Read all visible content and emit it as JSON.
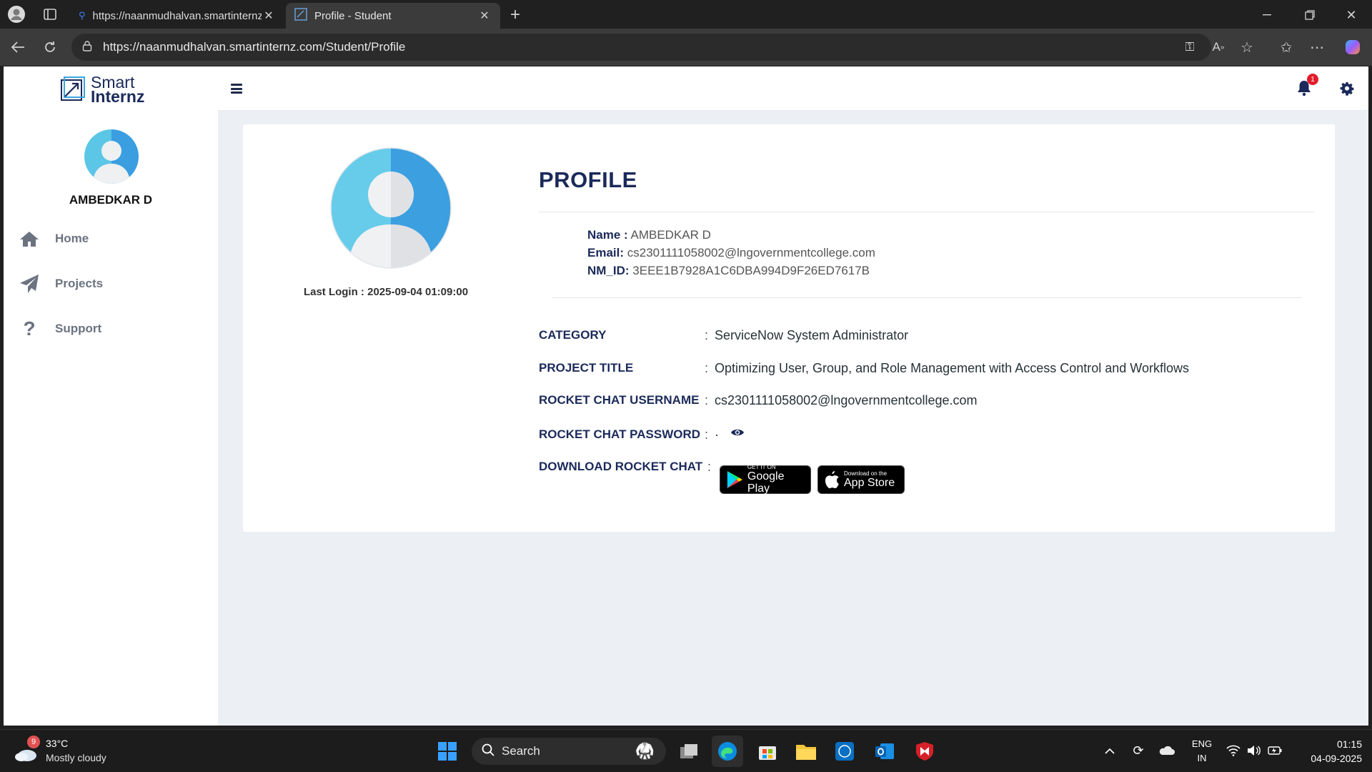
{
  "browser": {
    "tabs": [
      {
        "title": "https://naanmudhalvan.smartinternz.com",
        "icon": "search-icon",
        "active": false
      },
      {
        "title": "Profile - Student",
        "icon": "favicon-icon",
        "active": true
      }
    ],
    "url": "https://naanmudhalvan.smartinternz.com/Student/Profile"
  },
  "app": {
    "logo": {
      "line1": "Smart",
      "line2": "Internz"
    },
    "user_name": "AMBEDKAR D",
    "nav": [
      {
        "label": "Home",
        "icon": "home-icon"
      },
      {
        "label": "Projects",
        "icon": "paper-plane-icon"
      },
      {
        "label": "Support",
        "icon": "question-icon"
      }
    ],
    "notifications_count": "1"
  },
  "profile": {
    "heading": "PROFILE",
    "last_login": "Last Login : 2025-09-04 01:09:00",
    "name_label": "Name :",
    "name_value": "AMBEDKAR D",
    "email_label": "Email:",
    "email_value": "cs2301111058002@lngovernmentcollege.com",
    "nmid_label": "NM_ID:",
    "nmid_value": "3EEE1B7928A1C6DBA994D9F26ED7617B",
    "rows": [
      {
        "key": "CATEGORY",
        "value": "ServiceNow System Administrator"
      },
      {
        "key": "PROJECT TITLE",
        "value": "Optimizing User, Group, and Role Management with Access Control and Workflows"
      },
      {
        "key": "ROCKET CHAT USERNAME",
        "value": "cs2301111058002@lngovernmentcollege.com"
      },
      {
        "key": "ROCKET CHAT PASSWORD",
        "value": "·"
      },
      {
        "key": "DOWNLOAD ROCKET CHAT",
        "value": ""
      }
    ],
    "separator": ":",
    "google_play": {
      "small": "GET IT ON",
      "large": "Google Play"
    },
    "app_store": {
      "small": "Download on the",
      "large": "App Store"
    }
  },
  "taskbar": {
    "weather_badge": "9",
    "temperature": "33°C",
    "weather": "Mostly cloudy",
    "search_placeholder": "Search",
    "lang_line1": "ENG",
    "lang_line2": "IN",
    "time": "01:15",
    "date": "04-09-2025"
  },
  "colors": {
    "brand_navy": "#1b2a5a",
    "avatar_blue": "#3aa6e0",
    "badge_red": "#e11d2b"
  }
}
